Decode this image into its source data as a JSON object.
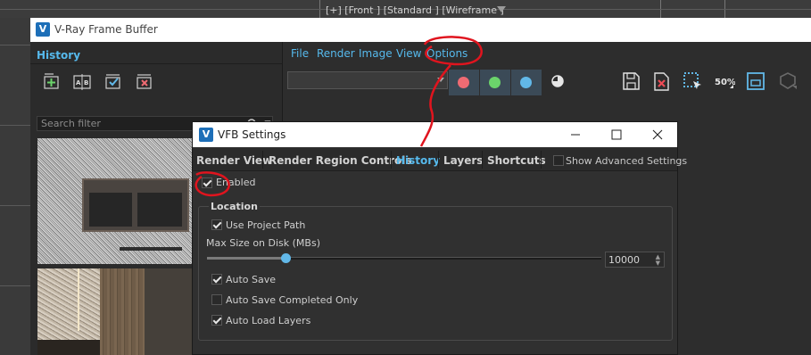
{
  "viewport": {
    "label": "[+] [Front ] [Standard ] [Wireframe ]"
  },
  "vfb": {
    "title": "V-Ray Frame Buffer",
    "logo": "V",
    "history": {
      "header": "History",
      "tool_icons": [
        "add-history-icon",
        "ab-compare-icon",
        "checkbox-icon",
        "delete-history-icon"
      ],
      "search_placeholder": "Search filter"
    },
    "menu": [
      "File",
      "Render",
      "Image",
      "View",
      "Options"
    ],
    "color_buttons": [
      {
        "name": "red",
        "color": "#ef6b73"
      },
      {
        "name": "green",
        "color": "#6bd36b"
      },
      {
        "name": "blue",
        "color": "#62b8e8"
      }
    ],
    "toolbar_icons": [
      "contrast-icon",
      "save-icon",
      "clear-image-icon",
      "region-select-icon",
      "zoom-50-icon",
      "frame-icon",
      "lens-icon"
    ],
    "zoom_label": "50%"
  },
  "dialog": {
    "title": "VFB Settings",
    "logo": "V",
    "tabs": [
      {
        "label": "Render View",
        "active": false
      },
      {
        "label": "Render Region Controls",
        "active": false
      },
      {
        "label": "History",
        "active": true
      },
      {
        "label": "Layers",
        "active": false
      },
      {
        "label": "Shortcuts",
        "active": false
      }
    ],
    "show_advanced_label": "Show Advanced Settings",
    "show_advanced_checked": false,
    "enabled_label": "Enabled",
    "enabled_checked": true,
    "location": {
      "title": "Location",
      "use_project_path_label": "Use Project Path",
      "use_project_path_checked": true,
      "max_size_label": "Max Size on Disk (MBs)",
      "max_size_value": "10000",
      "slider_fraction": 0.2
    },
    "auto_save_label": "Auto Save",
    "auto_save_checked": true,
    "auto_save_completed_label": "Auto Save Completed Only",
    "auto_save_completed_checked": false,
    "auto_load_layers_label": "Auto Load Layers",
    "auto_load_layers_checked": true
  },
  "colors": {
    "accent": "#56b9ec",
    "annotation": "#e0141e"
  }
}
